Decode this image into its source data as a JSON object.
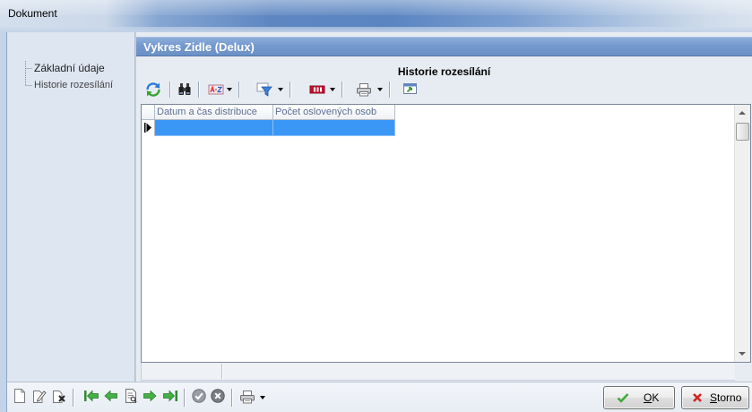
{
  "window": {
    "title": "Dokument"
  },
  "nav_tree": {
    "items": [
      {
        "label": "Základní údaje",
        "icon": "tree-branch-icon"
      },
      {
        "label": "Historie rozesílání",
        "icon": "tree-branch-icon"
      }
    ]
  },
  "document": {
    "title": "Vykres Zidle (Delux)"
  },
  "section": {
    "title": "Historie rozesílání"
  },
  "toolbar": {
    "items": [
      {
        "icon": "refresh-icon"
      },
      {
        "icon": "binoculars-icon"
      },
      {
        "icon": "sort-az-icon",
        "dropdown": true
      },
      {
        "icon": "filter-icon",
        "dropdown": true
      },
      {
        "icon": "columns-icon",
        "dropdown": true
      },
      {
        "icon": "printer-icon",
        "dropdown": true
      },
      {
        "icon": "export-icon"
      }
    ]
  },
  "grid": {
    "columns": [
      "Datum a čas distribuce",
      "Počet oslovených osob"
    ],
    "rows": [
      [
        "",
        ""
      ]
    ],
    "selected_row": 0
  },
  "footer_toolbar": {
    "items": [
      "new-document-icon",
      "edit-document-icon",
      "delete-document-icon",
      "first-record-icon",
      "previous-record-icon",
      "view-document-icon",
      "next-record-icon",
      "last-record-icon",
      "approve-icon",
      "reject-icon",
      "printer-icon"
    ]
  },
  "buttons": {
    "ok": "OK",
    "cancel": "Storno"
  },
  "colors": {
    "selection": "#3b97f6",
    "header_bar": "#6a90c6",
    "column_header_text": "#5d6f93"
  }
}
